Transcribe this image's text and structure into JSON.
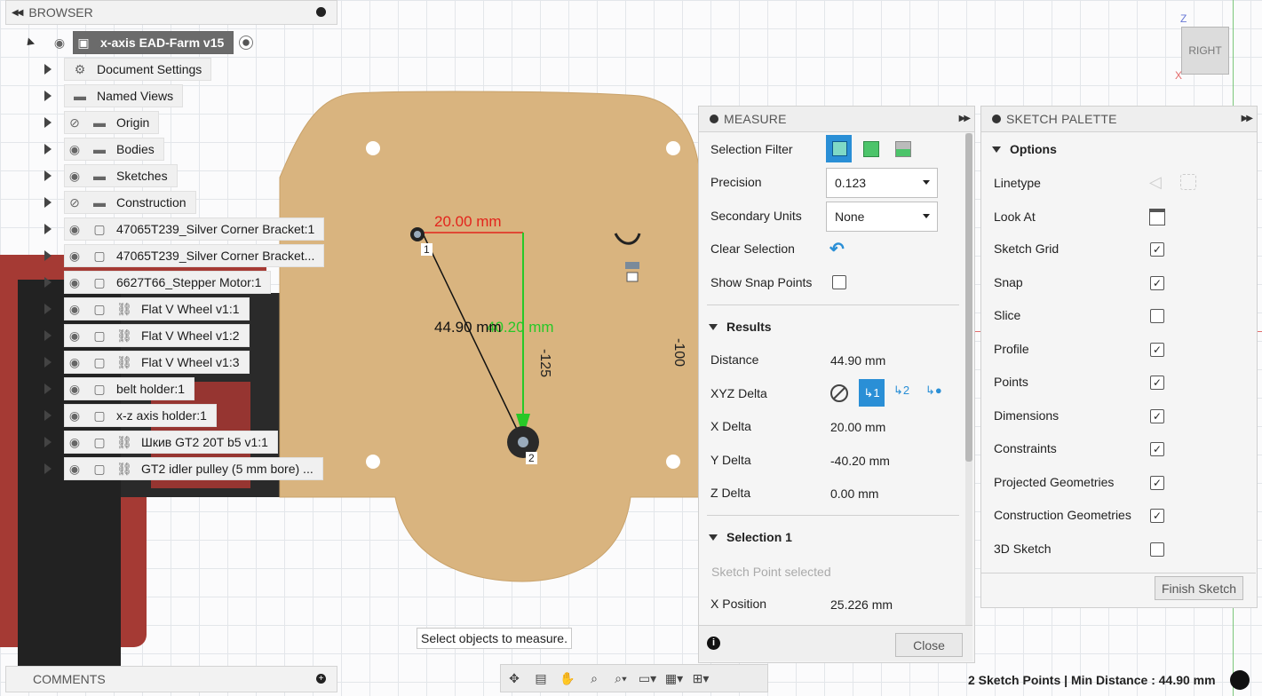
{
  "browser": {
    "title": "BROWSER",
    "root_label": "x-axis EAD-Farm v15",
    "items": [
      {
        "label": "Document Settings"
      },
      {
        "label": "Named Views"
      },
      {
        "label": "Origin"
      },
      {
        "label": "Bodies"
      },
      {
        "label": "Sketches"
      },
      {
        "label": "Construction"
      },
      {
        "label": "47065T239_Silver Corner Bracket:1"
      },
      {
        "label": "47065T239_Silver Corner Bracket..."
      },
      {
        "label": "6627T66_Stepper Motor:1"
      },
      {
        "label": "Flat V Wheel v1:1"
      },
      {
        "label": "Flat V Wheel v1:2"
      },
      {
        "label": "Flat V Wheel v1:3"
      },
      {
        "label": "belt holder:1"
      },
      {
        "label": "x-z axis holder:1"
      },
      {
        "label": "Шкив GT2 20T b5 v1:1"
      },
      {
        "label": "GT2 idler pulley (5 mm bore) ..."
      }
    ]
  },
  "comments": {
    "title": "COMMENTS"
  },
  "canvas": {
    "dim_x": "20.00 mm",
    "dim_y": "40.20 mm",
    "dim_dist": "44.90 mm",
    "point1": "1",
    "point2": "2",
    "ruler_a": "-125",
    "ruler_b": "-100"
  },
  "viewcube": {
    "face": "RIGHT",
    "axis_z": "Z",
    "axis_x": "X"
  },
  "measure": {
    "title": "MEASURE",
    "selection_filter_label": "Selection Filter",
    "precision_label": "Precision",
    "precision_value": "0.123",
    "secondary_units_label": "Secondary Units",
    "secondary_units_value": "None",
    "clear_selection_label": "Clear Selection",
    "show_snap_points_label": "Show Snap Points",
    "results_label": "Results",
    "distance_label": "Distance",
    "distance_value": "44.90 mm",
    "xyz_delta_label": "XYZ Delta",
    "x_delta_label": "X Delta",
    "x_delta_value": "20.00 mm",
    "y_delta_label": "Y Delta",
    "y_delta_value": "-40.20 mm",
    "z_delta_label": "Z Delta",
    "z_delta_value": "0.00 mm",
    "selection1_label": "Selection 1",
    "selection1_status": "Sketch Point selected",
    "x_position_label": "X Position",
    "x_position_value": "25.226 mm",
    "close_label": "Close"
  },
  "palette": {
    "title": "SKETCH PALETTE",
    "options_label": "Options",
    "linetype_label": "Linetype",
    "look_at_label": "Look At",
    "options": [
      {
        "label": "Sketch Grid",
        "checked": true
      },
      {
        "label": "Snap",
        "checked": true
      },
      {
        "label": "Slice",
        "checked": false
      },
      {
        "label": "Profile",
        "checked": true
      },
      {
        "label": "Points",
        "checked": true
      },
      {
        "label": "Dimensions",
        "checked": true
      },
      {
        "label": "Constraints",
        "checked": true
      },
      {
        "label": "Projected Geometries",
        "checked": true
      },
      {
        "label": "Construction Geometries",
        "checked": true
      },
      {
        "label": "3D Sketch",
        "checked": false
      }
    ],
    "finish_label": "Finish Sketch"
  },
  "tooltip": "Select objects to measure.",
  "status": "2 Sketch Points | Min Distance : 44.90 mm",
  "colors": {
    "dim_red": "#e3241c",
    "dim_green": "#27c827",
    "plate": "#d9b47f",
    "accent": "#2a8fd6"
  }
}
